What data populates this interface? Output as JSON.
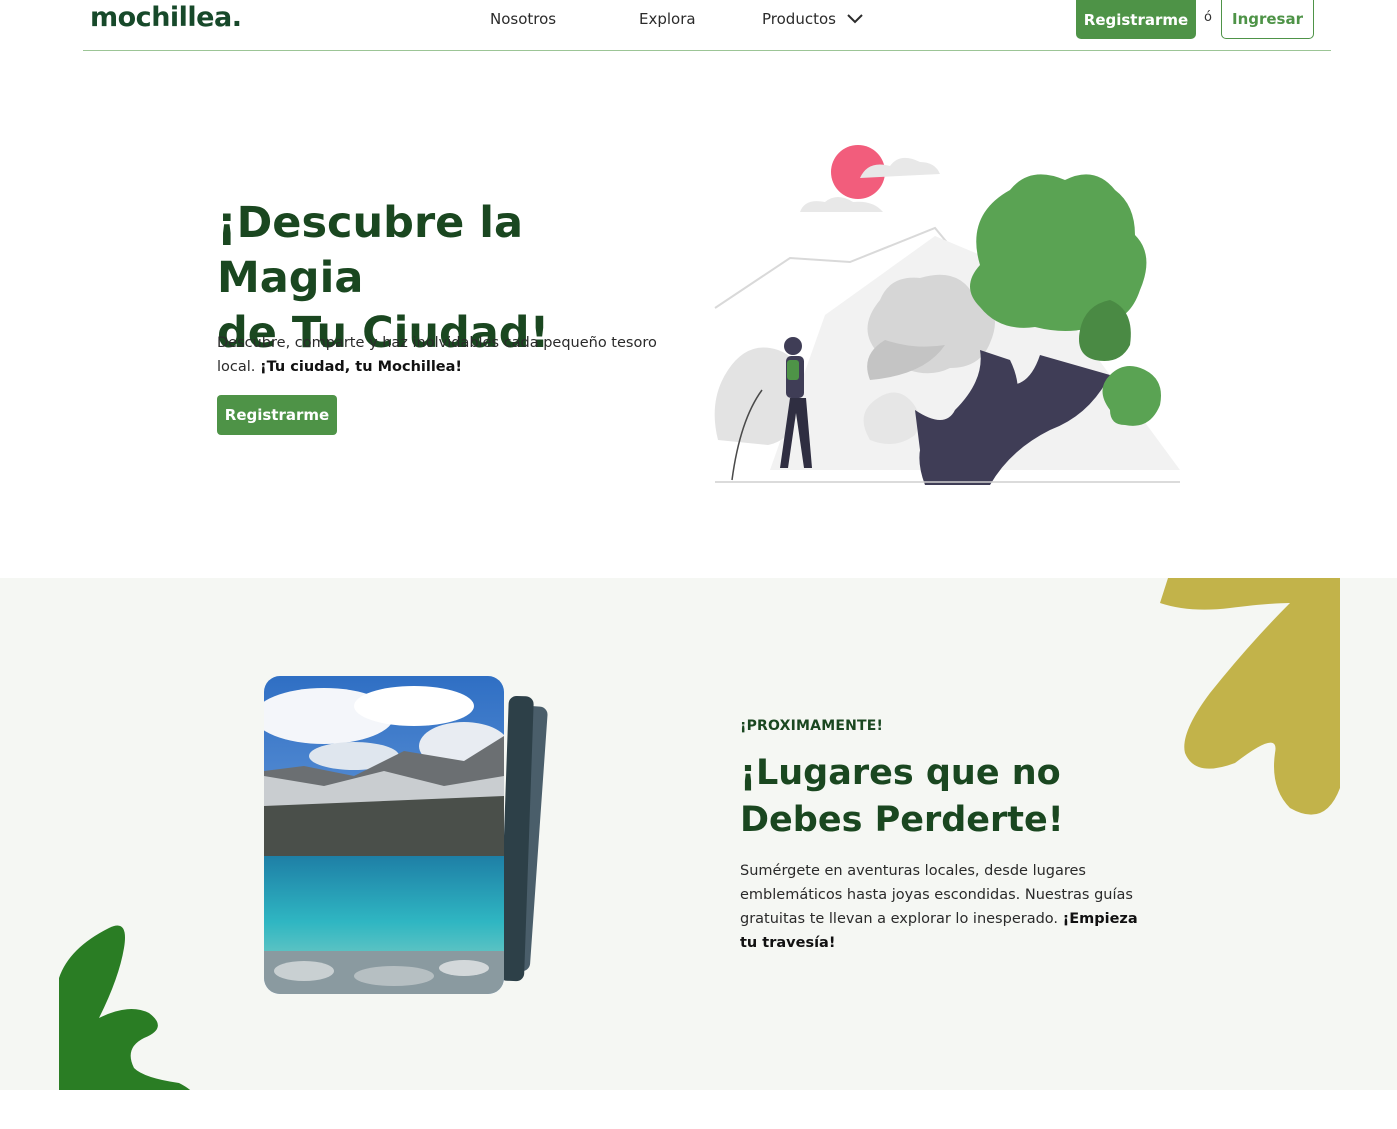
{
  "header": {
    "logo_text": "mochillea.",
    "nav": {
      "nosotros": "Nosotros",
      "explora": "Explora",
      "productos": "Productos"
    },
    "register_label": "Registrarme",
    "or_text": "ó",
    "login_label": "Ingresar"
  },
  "hero": {
    "title_line1": "¡Descubre la Magia",
    "title_line2": "de Tu Ciudad!",
    "desc_plain": "Descubre, comparte y haz inolvidables cada pequeño tesoro local. ",
    "desc_bold": "¡Tu ciudad, tu Mochillea!",
    "cta_label": "Registrarme"
  },
  "section2": {
    "kicker": "¡PROXIMAMENTE!",
    "title_line1": "¡Lugares que no",
    "title_line2": "Debes Perderte!",
    "desc_plain": "Sumérgete en aventuras locales, desde lugares emblemáticos hasta joyas escondidas. Nuestras guías gratuitas te llevan a explorar lo inesperado. ",
    "desc_bold": "¡Empieza tu travesía!"
  },
  "colors": {
    "brand_green": "#4e9347",
    "dark_green": "#1a4720",
    "logo_accent": "#e1622b",
    "blob_yellow": "#c2b34a",
    "blob_green": "#2a7d24",
    "section_bg": "#f5f7f3"
  },
  "icons": {
    "productos_chevron": "chevron-down-icon"
  }
}
